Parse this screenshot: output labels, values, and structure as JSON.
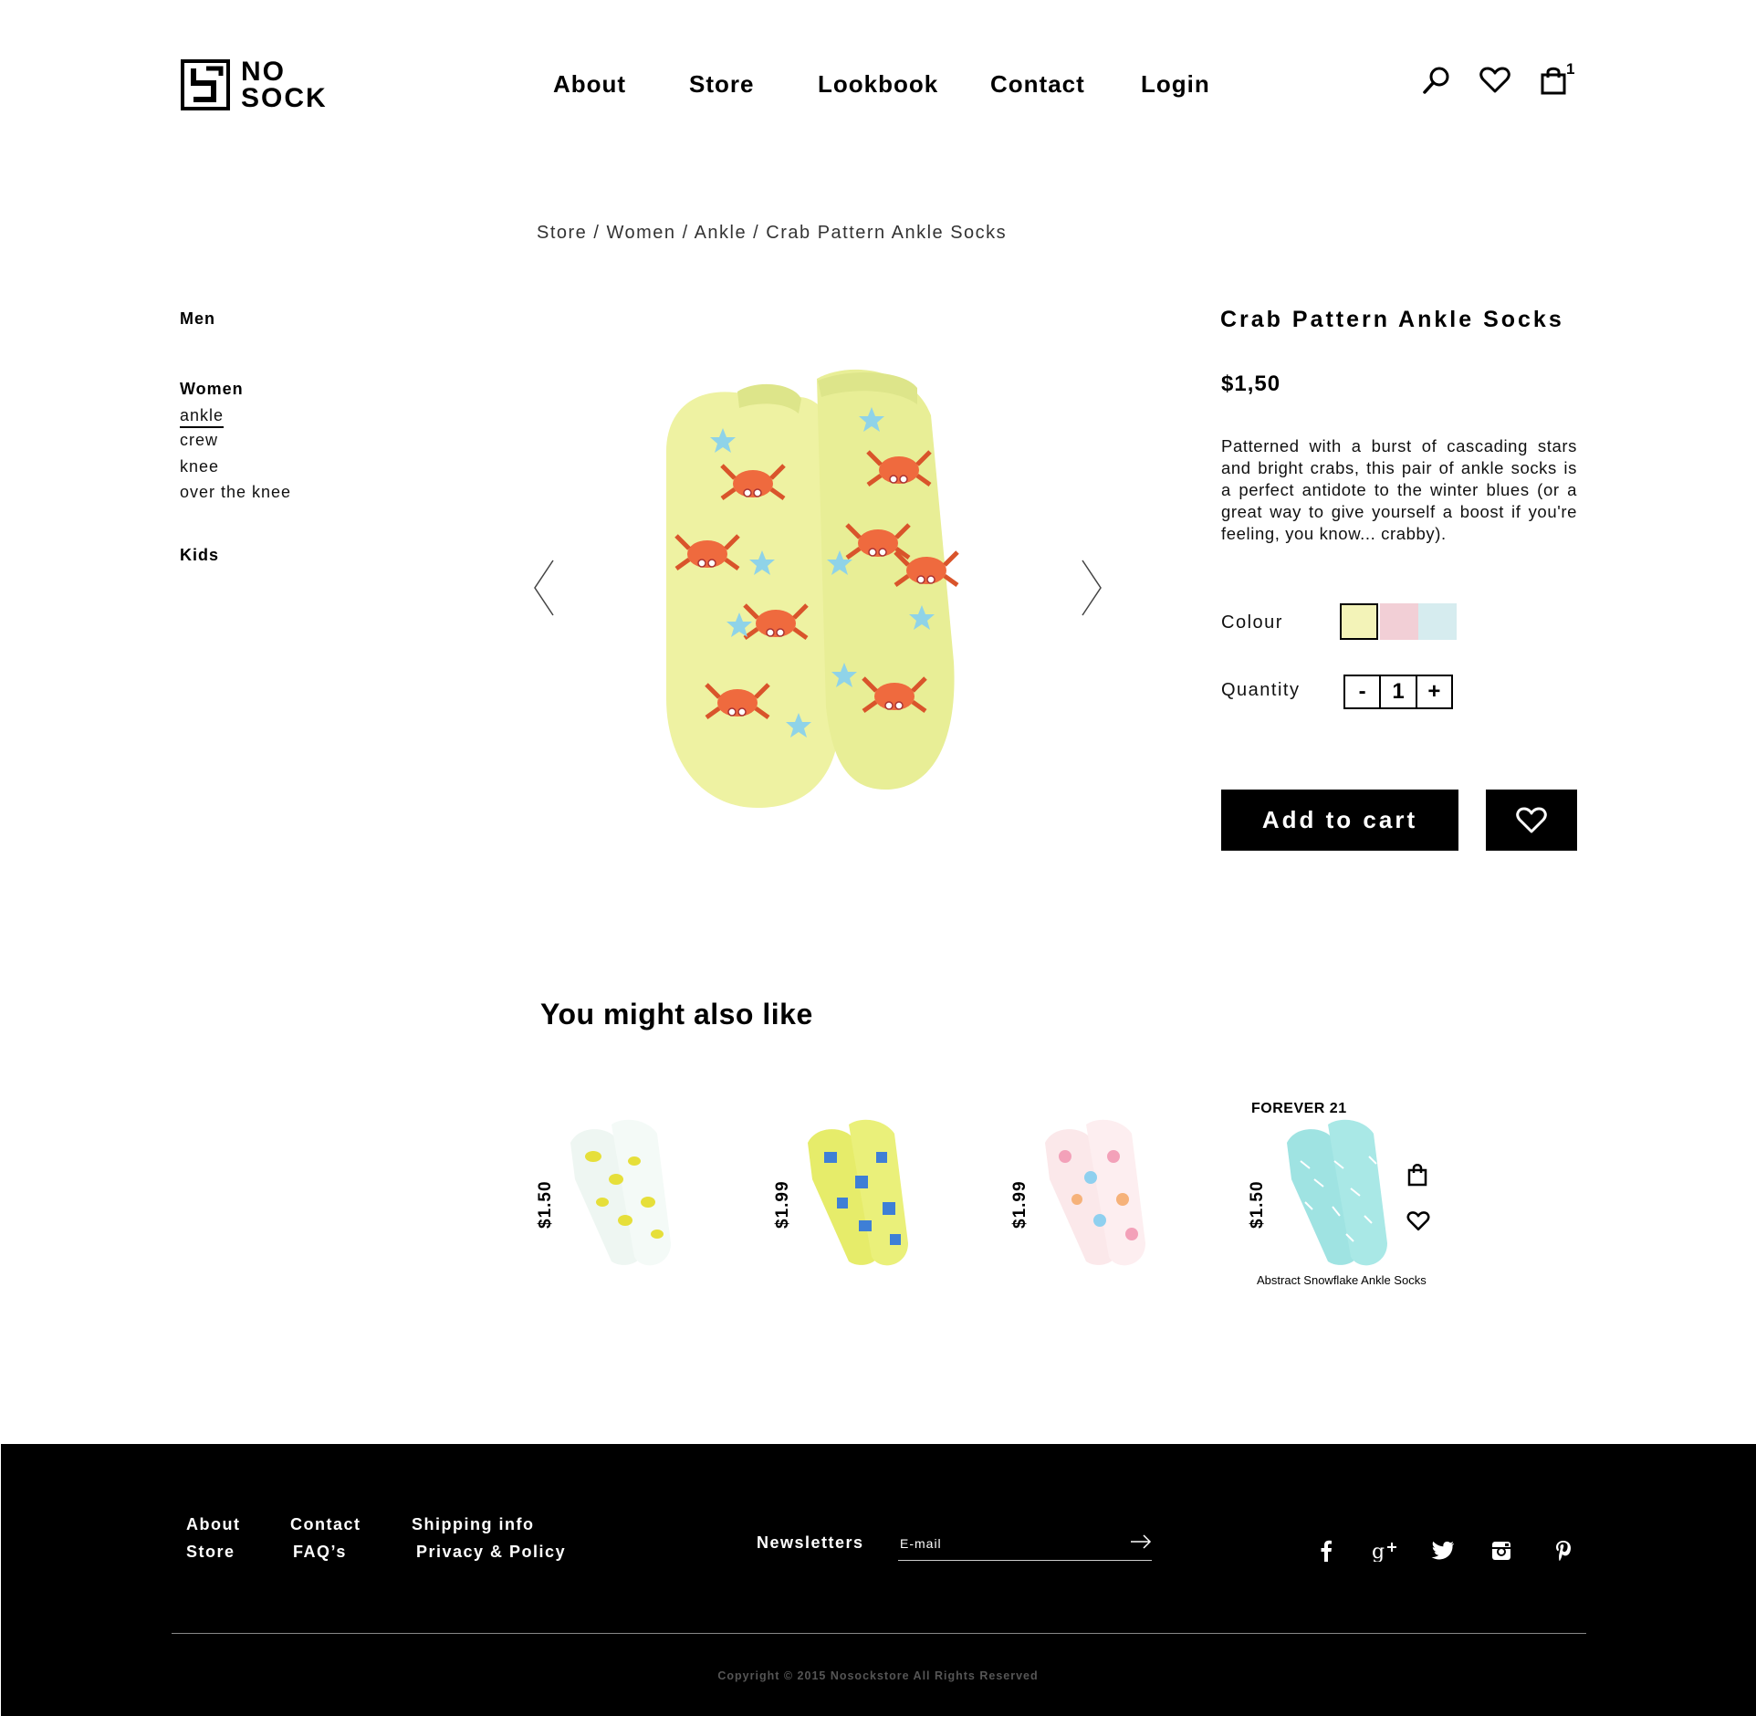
{
  "brand": {
    "logo_line1": "NO",
    "logo_line2": "SOCK"
  },
  "nav": {
    "about": "About",
    "store": "Store",
    "lookbook": "Lookbook",
    "contact": "Contact",
    "login": "Login"
  },
  "header_icons": {
    "search": "search-icon",
    "wishlist": "heart-icon",
    "cart": "shopping-bag-icon",
    "cart_count": "1"
  },
  "breadcrumb": "Store / Women / Ankle / Crab Pattern Ankle Socks",
  "sidebar": {
    "men": "Men",
    "women": "Women",
    "women_items": [
      "ankle",
      "crew",
      "knee",
      "over the knee"
    ],
    "kids": "Kids"
  },
  "product": {
    "title": "Crab Pattern Ankle Socks",
    "price": "$1,50",
    "description": "Patterned with a burst of cascading stars and bright crabs, this pair of ankle socks is a perfect antidote to the winter blues (or a great way to give yourself a boost if you're feeling, you know... crabby).",
    "colour_label": "Colour",
    "colours": [
      "#f3f3b8",
      "#f2cfd6",
      "#d6ecef"
    ],
    "quantity_label": "Quantity",
    "qty_minus": "-",
    "quantity": "1",
    "qty_plus": "+",
    "add_to_cart": "Add to cart"
  },
  "related": {
    "title": "You might also like",
    "items": [
      {
        "price": "$1.50"
      },
      {
        "price": "$1.99"
      },
      {
        "price": "$1.99"
      },
      {
        "price": "$1.50",
        "brand": "FOREVER 21",
        "name": "Abstract Snowflake Ankle Socks"
      }
    ]
  },
  "footer": {
    "about": "About",
    "store": "Store",
    "contact": "Contact",
    "faq": "FAQ’s",
    "shipping": "Shipping info",
    "privacy": "Privacy & Policy",
    "newsletters": "Newsletters",
    "email_placeholder": "E-mail",
    "social": [
      "facebook-icon",
      "google-plus-icon",
      "twitter-icon",
      "instagram-icon",
      "pinterest-icon"
    ],
    "copyright": "Copyright © 2015 Nosockstore All Rights Reserved"
  }
}
